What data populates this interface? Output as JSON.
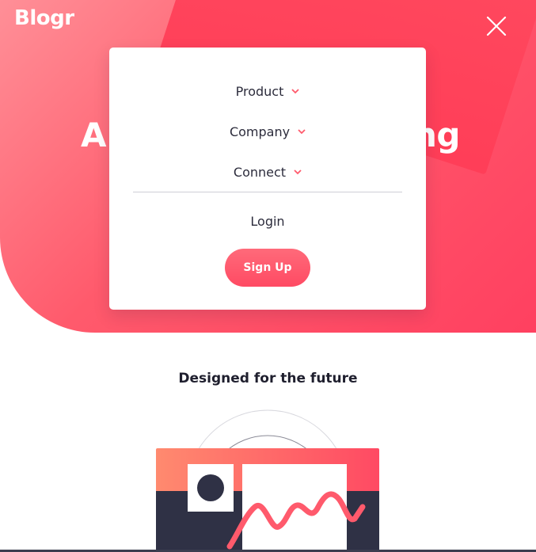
{
  "header": {
    "logo": "Blogr",
    "close_icon": "close-icon"
  },
  "hero": {
    "heading_left": "A",
    "heading_right": "ng"
  },
  "menu": {
    "items": [
      {
        "label": "Product",
        "icon": "chevron-down-icon"
      },
      {
        "label": "Company",
        "icon": "chevron-down-icon"
      },
      {
        "label": "Connect",
        "icon": "chevron-down-icon"
      }
    ],
    "login_label": "Login",
    "signup_label": "Sign Up"
  },
  "section": {
    "title": "Designed for the future"
  },
  "colors": {
    "accent": "#ff4a63",
    "accent_light": "#ff8f97",
    "dark": "#2f3145",
    "text": "#2c2c3c"
  }
}
